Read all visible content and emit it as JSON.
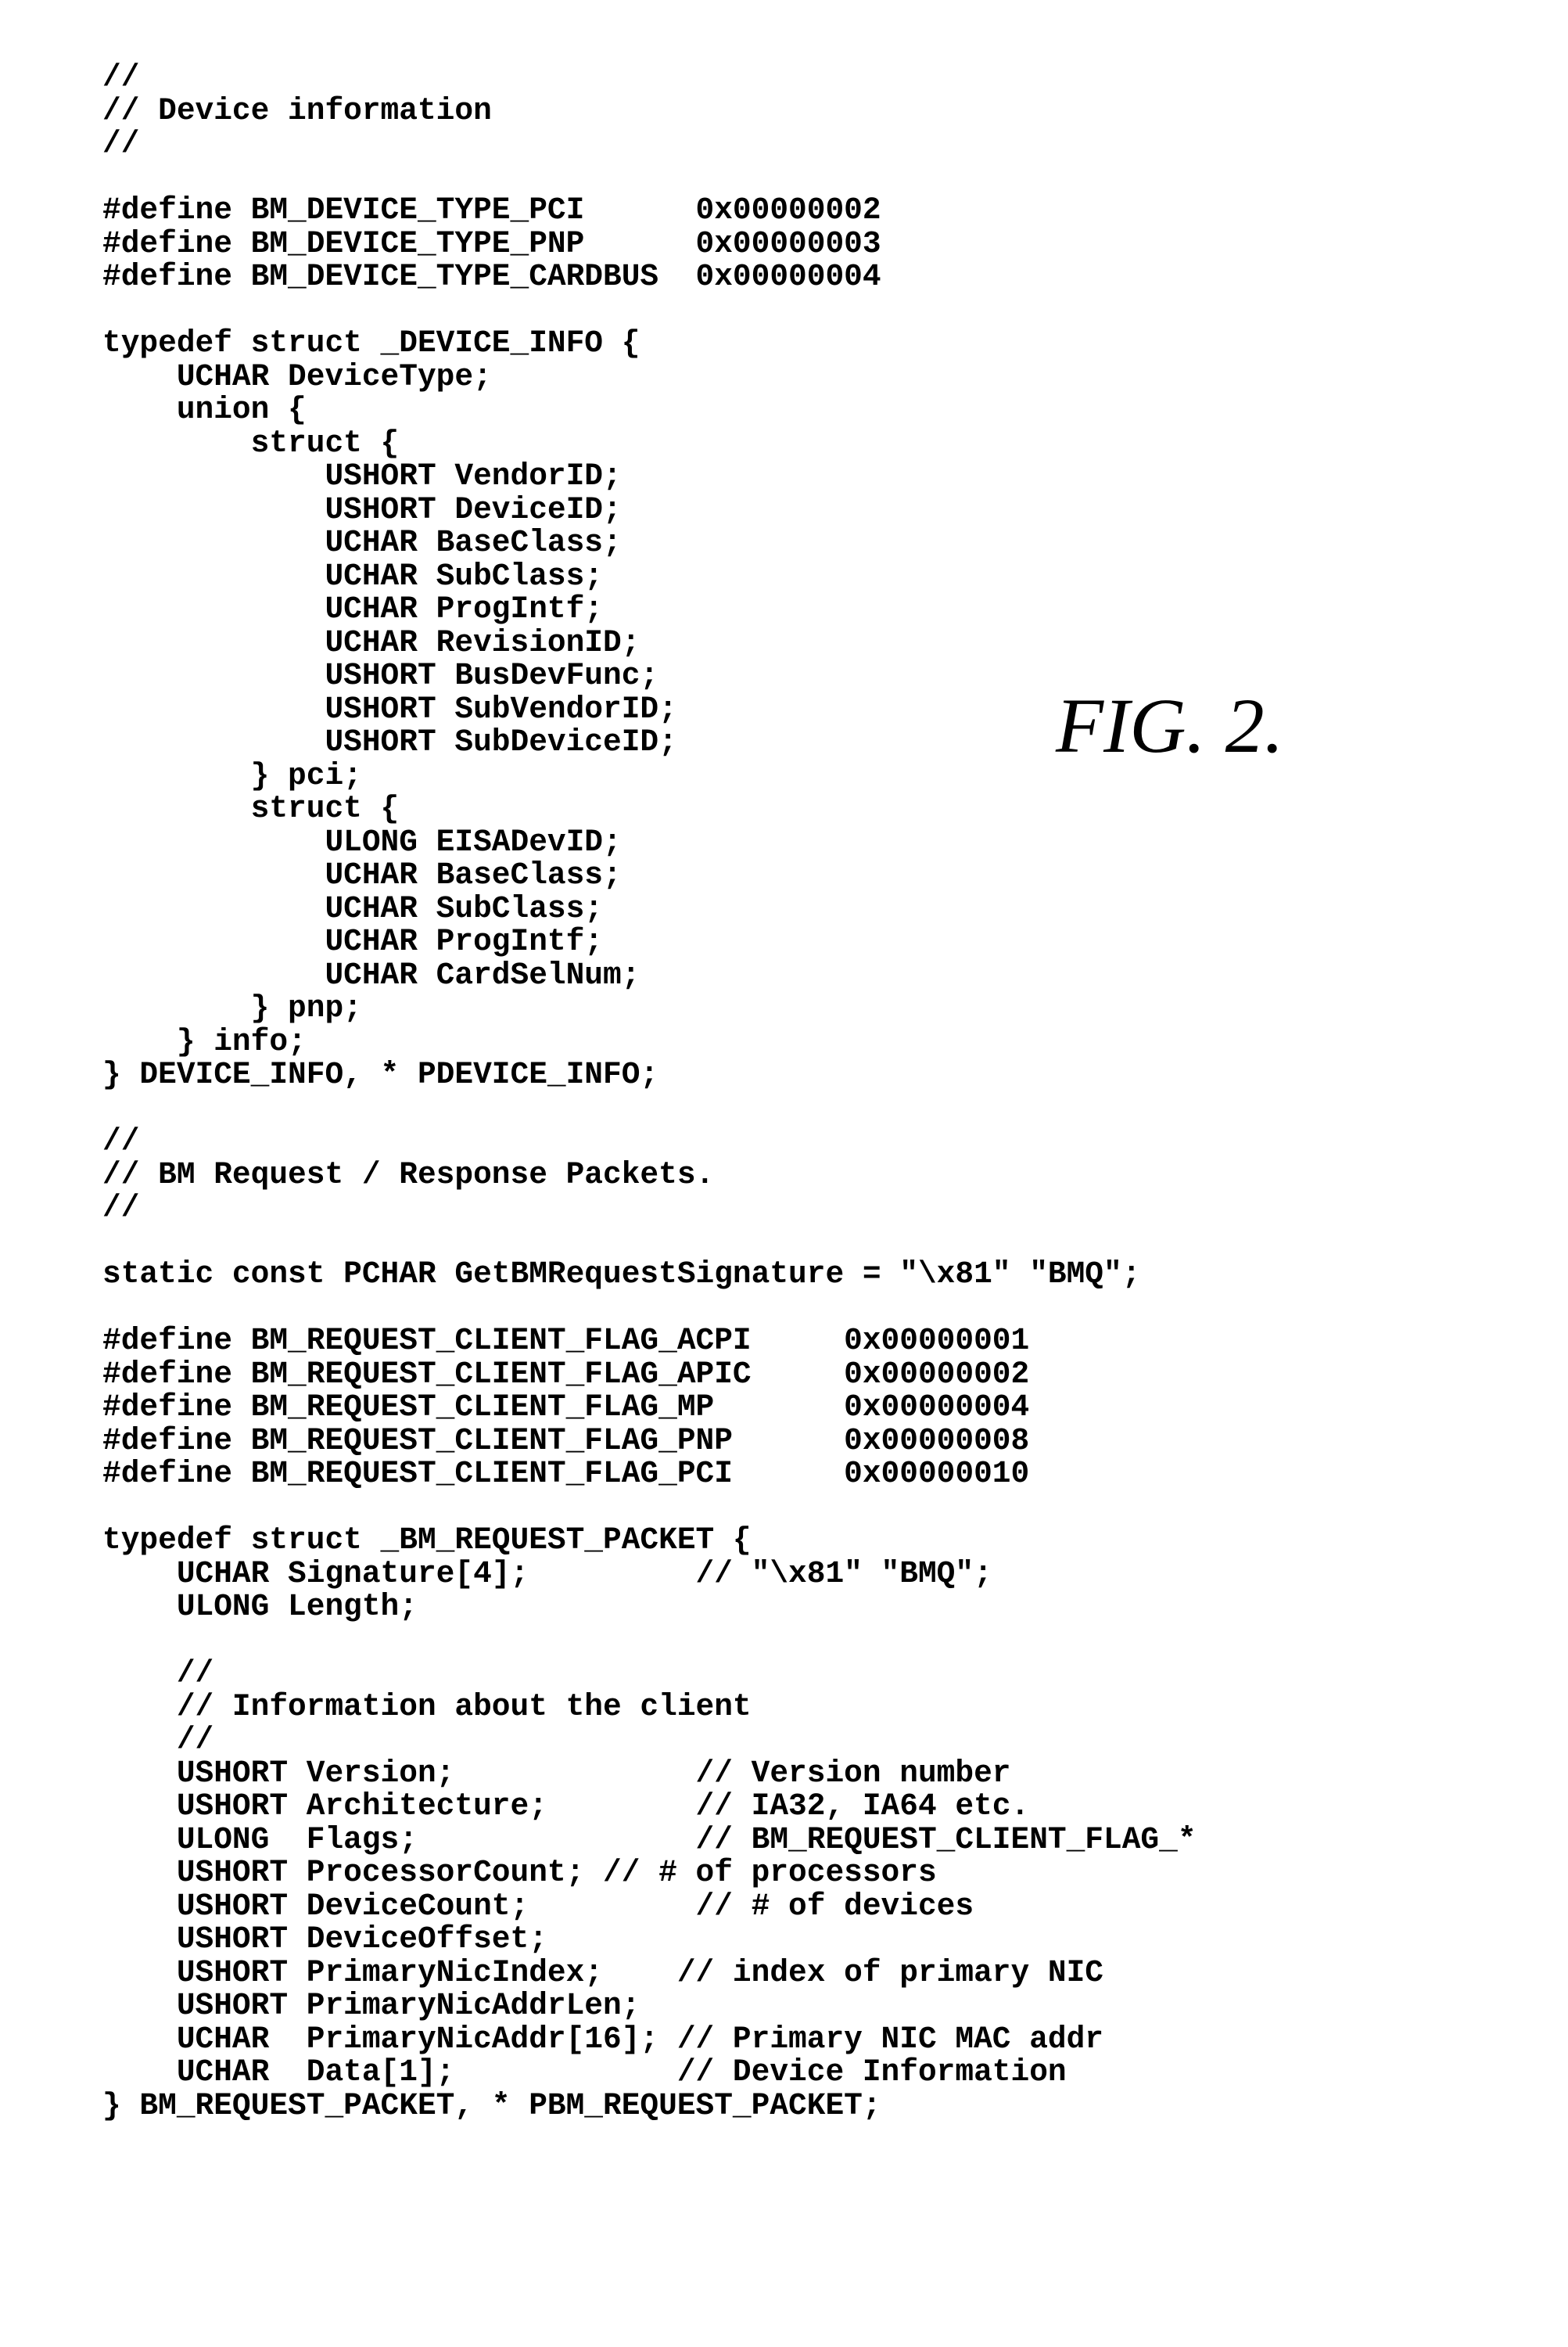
{
  "figure_label": "FIG. 2.",
  "code_lines": [
    "//",
    "// Device information",
    "//",
    "",
    "#define BM_DEVICE_TYPE_PCI      0x00000002",
    "#define BM_DEVICE_TYPE_PNP      0x00000003",
    "#define BM_DEVICE_TYPE_CARDBUS  0x00000004",
    "",
    "typedef struct _DEVICE_INFO {",
    "    UCHAR DeviceType;",
    "    union {",
    "        struct {",
    "            USHORT VendorID;",
    "            USHORT DeviceID;",
    "            UCHAR BaseClass;",
    "            UCHAR SubClass;",
    "            UCHAR ProgIntf;",
    "            UCHAR RevisionID;",
    "            USHORT BusDevFunc;",
    "            USHORT SubVendorID;",
    "            USHORT SubDeviceID;",
    "        } pci;",
    "        struct {",
    "            ULONG EISADevID;",
    "            UCHAR BaseClass;",
    "            UCHAR SubClass;",
    "            UCHAR ProgIntf;",
    "            UCHAR CardSelNum;",
    "        } pnp;",
    "    } info;",
    "} DEVICE_INFO, * PDEVICE_INFO;",
    "",
    "//",
    "// BM Request / Response Packets.",
    "//",
    "",
    "static const PCHAR GetBMRequestSignature = \"\\x81\" \"BMQ\";",
    "",
    "#define BM_REQUEST_CLIENT_FLAG_ACPI     0x00000001",
    "#define BM_REQUEST_CLIENT_FLAG_APIC     0x00000002",
    "#define BM_REQUEST_CLIENT_FLAG_MP       0x00000004",
    "#define BM_REQUEST_CLIENT_FLAG_PNP      0x00000008",
    "#define BM_REQUEST_CLIENT_FLAG_PCI      0x00000010",
    "",
    "typedef struct _BM_REQUEST_PACKET {",
    "    UCHAR Signature[4];         // \"\\x81\" \"BMQ\";",
    "    ULONG Length;",
    "",
    "    //",
    "    // Information about the client",
    "    //",
    "    USHORT Version;             // Version number",
    "    USHORT Architecture;        // IA32, IA64 etc.",
    "    ULONG  Flags;               // BM_REQUEST_CLIENT_FLAG_*",
    "    USHORT ProcessorCount; // # of processors",
    "    USHORT DeviceCount;         // # of devices",
    "    USHORT DeviceOffset;",
    "    USHORT PrimaryNicIndex;    // index of primary NIC",
    "    USHORT PrimaryNicAddrLen;",
    "    UCHAR  PrimaryNicAddr[16]; // Primary NIC MAC addr",
    "    UCHAR  Data[1];            // Device Information",
    "} BM_REQUEST_PACKET, * PBM_REQUEST_PACKET;"
  ]
}
